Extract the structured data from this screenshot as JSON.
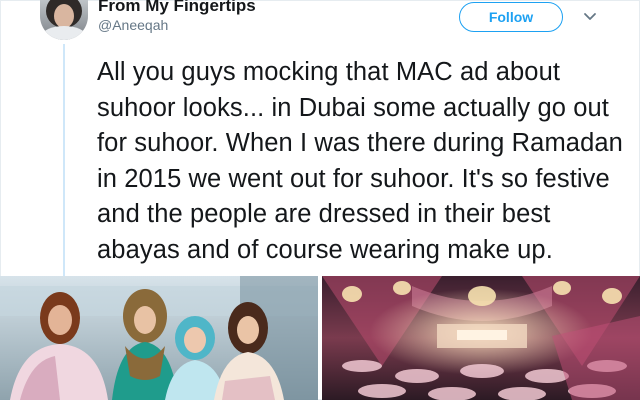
{
  "tweet": {
    "display_name": "From My Fingertips",
    "handle": "@Aneeqah",
    "follow_label": "Follow",
    "text": "All you guys mocking that MAC ad about suhoor looks... in Dubai some actually go out for suhoor. When I was there during Ramadan in 2015 we went out for suhoor. It's so festive and the people are dressed in their best abayas and of course wearing make up."
  },
  "icons": {
    "avatar": "avatar",
    "more": "chevron-down-icon"
  },
  "colors": {
    "accent": "#1da1f2",
    "text": "#14171a",
    "muted": "#657786"
  }
}
